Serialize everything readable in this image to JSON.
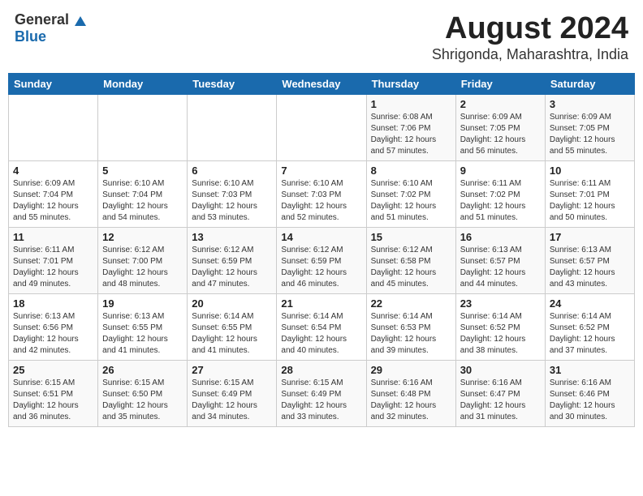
{
  "header": {
    "logo_general": "General",
    "logo_blue": "Blue",
    "month_title": "August 2024",
    "location": "Shrigonda, Maharashtra, India"
  },
  "days_of_week": [
    "Sunday",
    "Monday",
    "Tuesday",
    "Wednesday",
    "Thursday",
    "Friday",
    "Saturday"
  ],
  "weeks": [
    [
      {
        "day": "",
        "info": ""
      },
      {
        "day": "",
        "info": ""
      },
      {
        "day": "",
        "info": ""
      },
      {
        "day": "",
        "info": ""
      },
      {
        "day": "1",
        "info": "Sunrise: 6:08 AM\nSunset: 7:06 PM\nDaylight: 12 hours\nand 57 minutes."
      },
      {
        "day": "2",
        "info": "Sunrise: 6:09 AM\nSunset: 7:05 PM\nDaylight: 12 hours\nand 56 minutes."
      },
      {
        "day": "3",
        "info": "Sunrise: 6:09 AM\nSunset: 7:05 PM\nDaylight: 12 hours\nand 55 minutes."
      }
    ],
    [
      {
        "day": "4",
        "info": "Sunrise: 6:09 AM\nSunset: 7:04 PM\nDaylight: 12 hours\nand 55 minutes."
      },
      {
        "day": "5",
        "info": "Sunrise: 6:10 AM\nSunset: 7:04 PM\nDaylight: 12 hours\nand 54 minutes."
      },
      {
        "day": "6",
        "info": "Sunrise: 6:10 AM\nSunset: 7:03 PM\nDaylight: 12 hours\nand 53 minutes."
      },
      {
        "day": "7",
        "info": "Sunrise: 6:10 AM\nSunset: 7:03 PM\nDaylight: 12 hours\nand 52 minutes."
      },
      {
        "day": "8",
        "info": "Sunrise: 6:10 AM\nSunset: 7:02 PM\nDaylight: 12 hours\nand 51 minutes."
      },
      {
        "day": "9",
        "info": "Sunrise: 6:11 AM\nSunset: 7:02 PM\nDaylight: 12 hours\nand 51 minutes."
      },
      {
        "day": "10",
        "info": "Sunrise: 6:11 AM\nSunset: 7:01 PM\nDaylight: 12 hours\nand 50 minutes."
      }
    ],
    [
      {
        "day": "11",
        "info": "Sunrise: 6:11 AM\nSunset: 7:01 PM\nDaylight: 12 hours\nand 49 minutes."
      },
      {
        "day": "12",
        "info": "Sunrise: 6:12 AM\nSunset: 7:00 PM\nDaylight: 12 hours\nand 48 minutes."
      },
      {
        "day": "13",
        "info": "Sunrise: 6:12 AM\nSunset: 6:59 PM\nDaylight: 12 hours\nand 47 minutes."
      },
      {
        "day": "14",
        "info": "Sunrise: 6:12 AM\nSunset: 6:59 PM\nDaylight: 12 hours\nand 46 minutes."
      },
      {
        "day": "15",
        "info": "Sunrise: 6:12 AM\nSunset: 6:58 PM\nDaylight: 12 hours\nand 45 minutes."
      },
      {
        "day": "16",
        "info": "Sunrise: 6:13 AM\nSunset: 6:57 PM\nDaylight: 12 hours\nand 44 minutes."
      },
      {
        "day": "17",
        "info": "Sunrise: 6:13 AM\nSunset: 6:57 PM\nDaylight: 12 hours\nand 43 minutes."
      }
    ],
    [
      {
        "day": "18",
        "info": "Sunrise: 6:13 AM\nSunset: 6:56 PM\nDaylight: 12 hours\nand 42 minutes."
      },
      {
        "day": "19",
        "info": "Sunrise: 6:13 AM\nSunset: 6:55 PM\nDaylight: 12 hours\nand 41 minutes."
      },
      {
        "day": "20",
        "info": "Sunrise: 6:14 AM\nSunset: 6:55 PM\nDaylight: 12 hours\nand 41 minutes."
      },
      {
        "day": "21",
        "info": "Sunrise: 6:14 AM\nSunset: 6:54 PM\nDaylight: 12 hours\nand 40 minutes."
      },
      {
        "day": "22",
        "info": "Sunrise: 6:14 AM\nSunset: 6:53 PM\nDaylight: 12 hours\nand 39 minutes."
      },
      {
        "day": "23",
        "info": "Sunrise: 6:14 AM\nSunset: 6:52 PM\nDaylight: 12 hours\nand 38 minutes."
      },
      {
        "day": "24",
        "info": "Sunrise: 6:14 AM\nSunset: 6:52 PM\nDaylight: 12 hours\nand 37 minutes."
      }
    ],
    [
      {
        "day": "25",
        "info": "Sunrise: 6:15 AM\nSunset: 6:51 PM\nDaylight: 12 hours\nand 36 minutes."
      },
      {
        "day": "26",
        "info": "Sunrise: 6:15 AM\nSunset: 6:50 PM\nDaylight: 12 hours\nand 35 minutes."
      },
      {
        "day": "27",
        "info": "Sunrise: 6:15 AM\nSunset: 6:49 PM\nDaylight: 12 hours\nand 34 minutes."
      },
      {
        "day": "28",
        "info": "Sunrise: 6:15 AM\nSunset: 6:49 PM\nDaylight: 12 hours\nand 33 minutes."
      },
      {
        "day": "29",
        "info": "Sunrise: 6:16 AM\nSunset: 6:48 PM\nDaylight: 12 hours\nand 32 minutes."
      },
      {
        "day": "30",
        "info": "Sunrise: 6:16 AM\nSunset: 6:47 PM\nDaylight: 12 hours\nand 31 minutes."
      },
      {
        "day": "31",
        "info": "Sunrise: 6:16 AM\nSunset: 6:46 PM\nDaylight: 12 hours\nand 30 minutes."
      }
    ]
  ]
}
